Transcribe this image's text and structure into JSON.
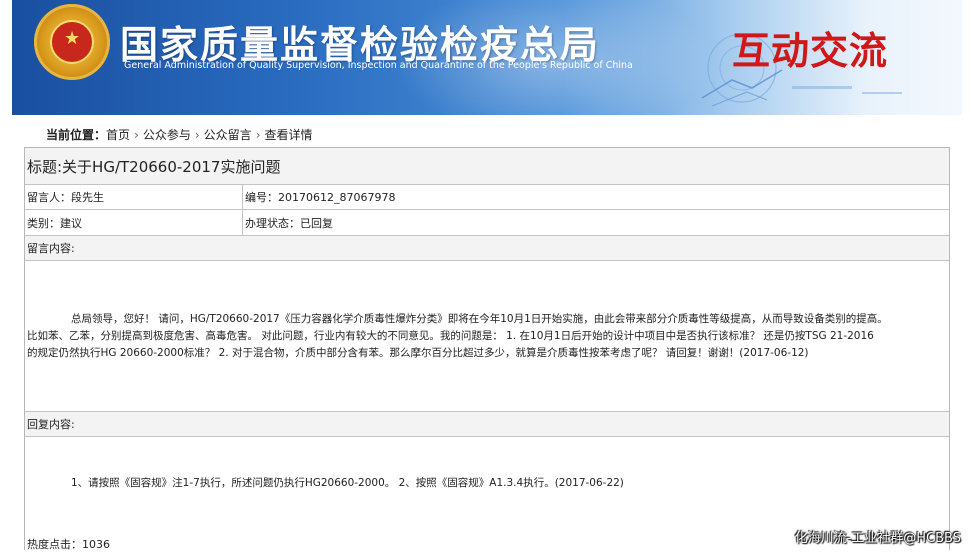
{
  "banner": {
    "title": "国家质量监督检验检疫总局",
    "subtitle": "General Administration of Quality Supervision, Inspection and Quarantine of the People's Republic of China",
    "section": "互动交流"
  },
  "breadcrumb": {
    "label": "当前位置：",
    "items": [
      "首页",
      "公众参与",
      "公众留言",
      "查看详情"
    ]
  },
  "message": {
    "title": "标题:关于HG/T20660-2017实施问题",
    "author": "留言人：段先生",
    "number": "编号：20170612_87067978",
    "category": "类别：建议",
    "status": "办理状态：已回复",
    "content_label": "留言内容:",
    "content": [
      "总局领导，您好！ 请问，HG/T20660-2017《压力容器化学介质毒性爆炸分类》即将在今年10月1日开始实施，由此会带来部分介质毒性等级提高，从而导致设备类别的提高。",
      "比如苯、乙苯，分别提高到极度危害、高毒危害。 对此问题，行业内有较大的不同意见。我的问题是： 1. 在10月1日后开始的设计中项目中是否执行该标准？ 还是仍按TSG 21-2016",
      "的规定仍然执行HG 20660-2000标准？ 2. 对于混合物，介质中部分含有苯。那么摩尔百分比超过多少，就算是介质毒性按苯考虑了呢？ 请回复！谢谢！(2017-06-12)"
    ],
    "reply_label": "回复内容:",
    "reply": "1、请按照《固容规》注1-7执行，所述问题仍执行HG20660-2000。 2、按照《固容规》A1.3.4执行。(2017-06-22)",
    "hits": "热度点击：1036"
  },
  "watermark": "化海川流-工业社群@HCBBS"
}
